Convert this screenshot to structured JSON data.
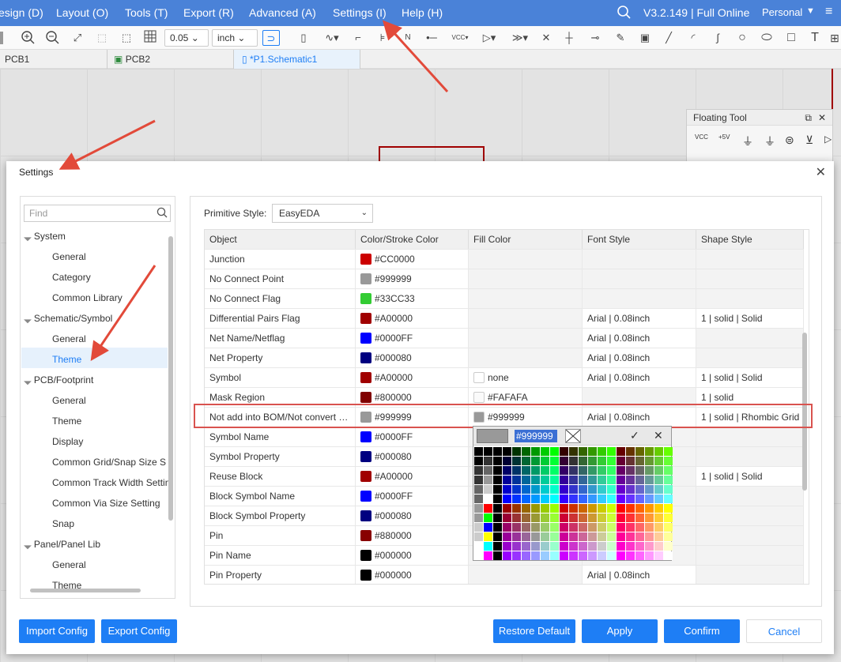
{
  "menu": {
    "items": [
      "esign (D)",
      "Layout (O)",
      "Tools (T)",
      "Export (R)",
      "Advanced (A)",
      "Settings (I)",
      "Help (H)"
    ],
    "version": "V3.2.149 | Full Online",
    "profile": "Personal"
  },
  "toolbar": {
    "grid": "0.05",
    "unit": "inch"
  },
  "tabs": [
    "PCB1",
    "PCB2",
    "*P1.Schematic1"
  ],
  "floating_tool": {
    "title": "Floating Tool",
    "icons": [
      "VCC",
      "+5V"
    ]
  },
  "dialog": {
    "title": "Settings",
    "find_placeholder": "Find",
    "tree": [
      {
        "label": "System",
        "level": 0,
        "expanded": true
      },
      {
        "label": "General",
        "level": 1
      },
      {
        "label": "Category",
        "level": 1
      },
      {
        "label": "Common Library",
        "level": 1
      },
      {
        "label": "Schematic/Symbol",
        "level": 0,
        "expanded": true
      },
      {
        "label": "General",
        "level": 1
      },
      {
        "label": "Theme",
        "level": 1,
        "selected": true
      },
      {
        "label": "PCB/Footprint",
        "level": 0,
        "expanded": true
      },
      {
        "label": "General",
        "level": 1
      },
      {
        "label": "Theme",
        "level": 1
      },
      {
        "label": "Display",
        "level": 1
      },
      {
        "label": "Common Grid/Snap Size S",
        "level": 1
      },
      {
        "label": "Common Track Width Settin",
        "level": 1
      },
      {
        "label": "Common Via Size Setting",
        "level": 1
      },
      {
        "label": "Snap",
        "level": 1
      },
      {
        "label": "Panel/Panel Lib",
        "level": 0,
        "expanded": true
      },
      {
        "label": "General",
        "level": 1
      },
      {
        "label": "Theme",
        "level": 1
      }
    ],
    "primitive_style_label": "Primitive Style:",
    "primitive_style_value": "EasyEDA",
    "columns": [
      "Object",
      "Color/Stroke Color",
      "Fill Color",
      "Font Style",
      "Shape Style"
    ],
    "rows": [
      {
        "object": "Junction",
        "stroke": "#CC0000",
        "fill": "",
        "font": "",
        "shape": ""
      },
      {
        "object": "No Connect Point",
        "stroke": "#999999",
        "fill": "",
        "font": "",
        "shape": ""
      },
      {
        "object": "No Connect Flag",
        "stroke": "#33CC33",
        "fill": "",
        "font": "",
        "shape": ""
      },
      {
        "object": "Differential Pairs Flag",
        "stroke": "#A00000",
        "fill": "",
        "font": "Arial | 0.08inch",
        "shape": "1 | solid | Solid"
      },
      {
        "object": "Net Name/Netflag",
        "stroke": "#0000FF",
        "fill": "",
        "font": "Arial | 0.08inch",
        "shape": ""
      },
      {
        "object": "Net Property",
        "stroke": "#000080",
        "fill": "",
        "font": "Arial | 0.08inch",
        "shape": ""
      },
      {
        "object": "Symbol",
        "stroke": "#A00000",
        "fill": "none",
        "fill_color": "#FFFFFF",
        "font": "Arial | 0.08inch",
        "shape": "1 | solid | Solid"
      },
      {
        "object": "Mask Region",
        "stroke": "#800000",
        "fill": "#FAFAFA",
        "fill_color": "#FAFAFA",
        "font": "",
        "shape": "1 | solid"
      },
      {
        "object": "Not add into BOM/Not convert …",
        "stroke": "#999999",
        "fill": "#999999",
        "fill_color": "#999999",
        "font": "Arial | 0.08inch",
        "shape": "1 | solid | Rhombic Grid"
      },
      {
        "object": "Symbol Name",
        "stroke": "#0000FF",
        "fill": "",
        "font": "",
        "shape": ""
      },
      {
        "object": "Symbol Property",
        "stroke": "#000080",
        "fill": "",
        "font": "",
        "shape": ""
      },
      {
        "object": "Reuse Block",
        "stroke": "#A00000",
        "fill": "",
        "font": "",
        "shape": "1 | solid | Solid"
      },
      {
        "object": "Block Symbol Name",
        "stroke": "#0000FF",
        "fill": "",
        "font": "",
        "shape": ""
      },
      {
        "object": "Block Symbol Property",
        "stroke": "#000080",
        "fill": "",
        "font": "",
        "shape": ""
      },
      {
        "object": "Pin",
        "stroke": "#880000",
        "fill": "",
        "font": "",
        "shape": ""
      },
      {
        "object": "Pin Name",
        "stroke": "#000000",
        "fill": "",
        "font": "",
        "shape": ""
      },
      {
        "object": "Pin Property",
        "stroke": "#000000",
        "fill": "",
        "font": "Arial | 0.08inch",
        "shape": ""
      }
    ],
    "picker_value": "#999999",
    "buttons": {
      "import": "Import Config",
      "export": "Export Config",
      "restore": "Restore Default",
      "apply": "Apply",
      "confirm": "Confirm",
      "cancel": "Cancel"
    }
  }
}
